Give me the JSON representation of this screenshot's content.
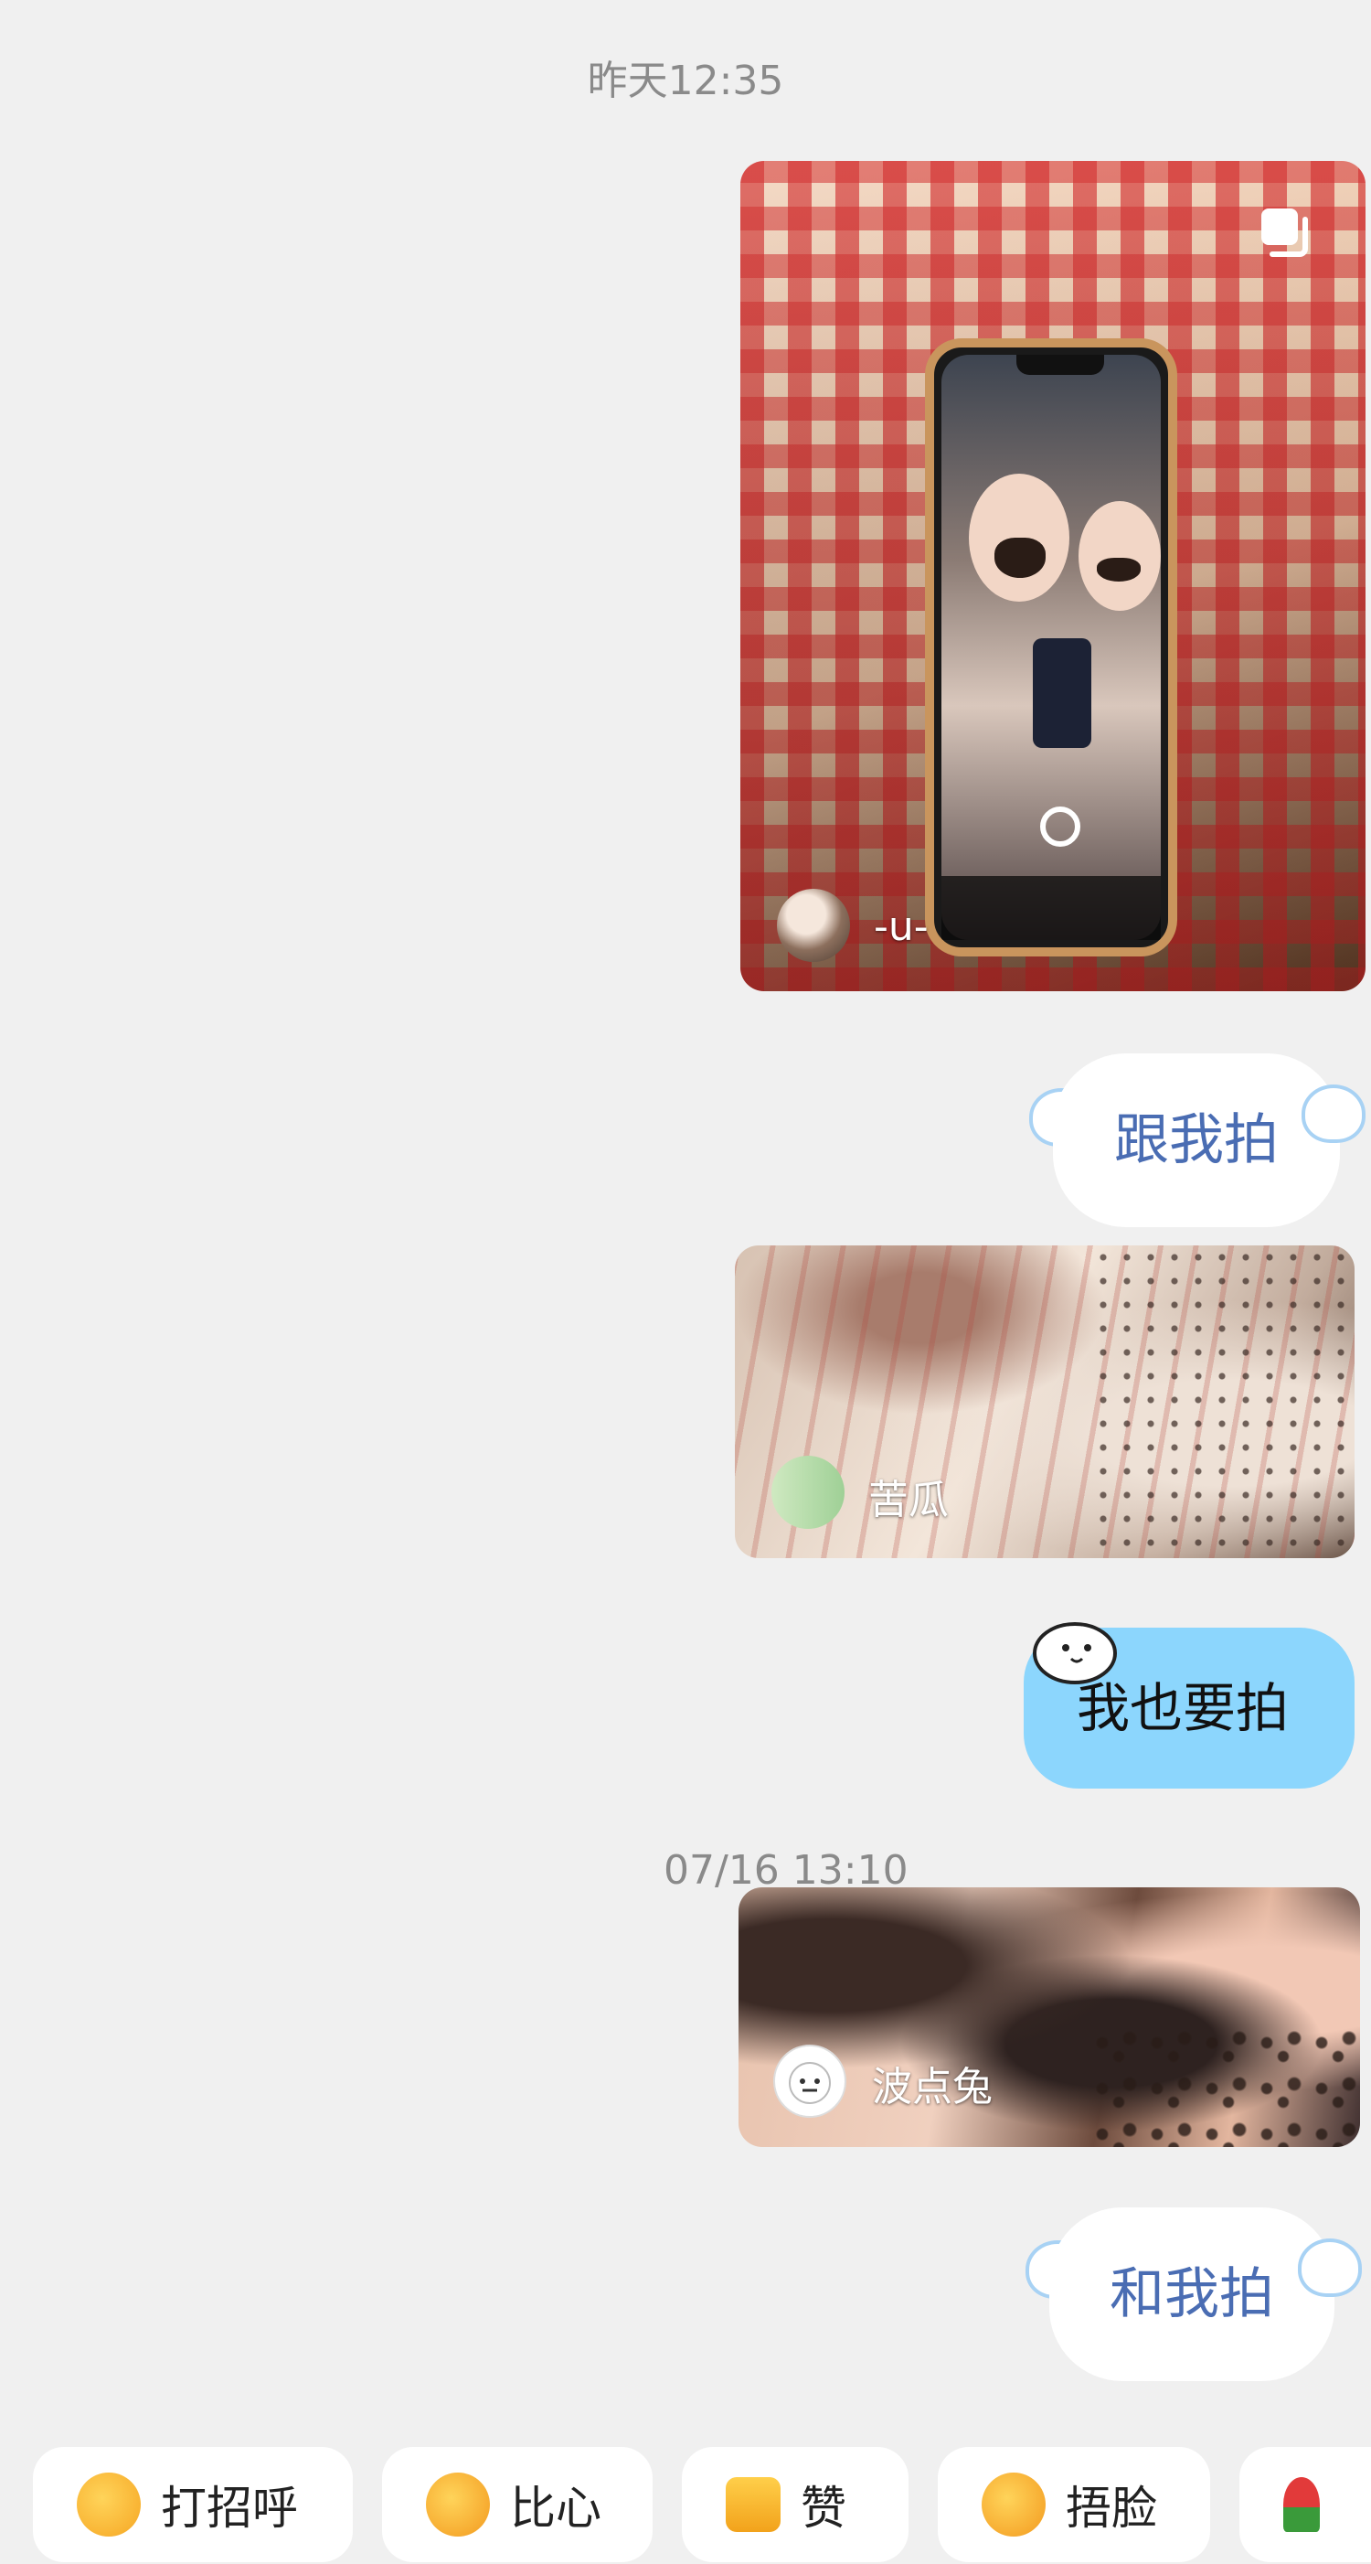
{
  "timestamps": [
    "昨天12:35",
    "07/16 13:10"
  ],
  "messages": {
    "m1": {
      "author": "-u-"
    },
    "m2": {
      "text": "跟我拍"
    },
    "m3": {
      "author": "苦瓜"
    },
    "m4": {
      "text": "我也要拍"
    },
    "m5": {
      "author": "波点兔"
    },
    "m6": {
      "text": "和我拍"
    }
  },
  "quick_replies": [
    {
      "label": "打招呼",
      "icon": "wave-emoji-icon"
    },
    {
      "label": "比心",
      "icon": "heart-hands-emoji-icon"
    },
    {
      "label": "赞",
      "icon": "thumbs-up-emoji-icon"
    },
    {
      "label": "捂脸",
      "icon": "facepalm-emoji-icon"
    },
    {
      "label": "",
      "icon": "rose-emoji-icon"
    }
  ],
  "colors": {
    "background": "#f0f0f0",
    "bubble_white_text": "#4a6db3",
    "bubble_blue": "#8cd6fd"
  }
}
